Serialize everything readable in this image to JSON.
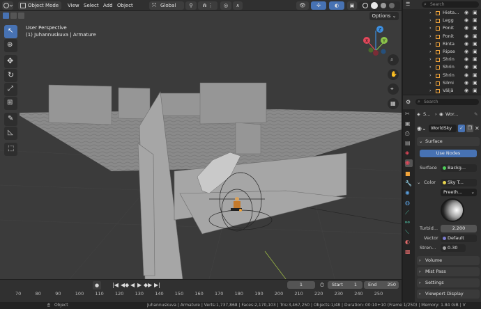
{
  "header": {
    "mode": "Object Mode",
    "menus": [
      "View",
      "Select",
      "Add",
      "Object"
    ],
    "transform_orientation": "Global",
    "options": "Options"
  },
  "viewport": {
    "perspective": "User Perspective",
    "collection": "(1) Juhannuskuva | Armature",
    "gizmo": {
      "x": "X",
      "y": "Y",
      "z": "Z"
    }
  },
  "outliner": {
    "search_placeholder": "Search",
    "items": [
      "Hieta...",
      "Legg",
      "Ponit",
      "Ponit",
      "Rinta",
      "Ripse",
      "Shrin",
      "Shrin",
      "Shrin",
      "Silmi",
      "Väljä"
    ]
  },
  "properties": {
    "search_placeholder": "Search",
    "breadcrumb": [
      "S...",
      "Wor..."
    ],
    "world_name": "WorldSky",
    "surface_panel": "Surface",
    "use_nodes": "Use Nodes",
    "surface_label": "Surface",
    "surface_value": "Backg...",
    "color_label": "Color",
    "color_value": "Sky T...",
    "sky_type": "Preeth...",
    "turbidity_label": "Turbid...",
    "turbidity_value": "2.200",
    "vector_label": "Vector",
    "vector_value": "Default",
    "strength_label": "Stren...",
    "strength_value": "0.30",
    "panels": [
      "Volume",
      "Mist Pass",
      "Settings",
      "Viewport Display"
    ]
  },
  "timeline": {
    "ticks": [
      "70",
      "80",
      "90",
      "100",
      "110",
      "120",
      "130",
      "140",
      "150",
      "160",
      "170",
      "180",
      "190",
      "200",
      "210",
      "220",
      "230",
      "240",
      "250"
    ],
    "current_frame": "1",
    "start_label": "Start",
    "start_value": "1",
    "end_label": "End",
    "end_value": "250"
  },
  "statusbar": {
    "left": "Object",
    "info": "Juhannuskuva | Armature | Verts:1,737,868 | Faces:2,170,103 | Tris:3,467,250 | Objects:1/48 | Duration: 00:10+10 (Frame 1/250) | Memory: 1.84 GiB | V"
  },
  "colors": {
    "accent": "#4772b3",
    "x_axis": "#e2475a",
    "y_axis": "#8bc34a",
    "z_axis": "#3d8fe0"
  }
}
